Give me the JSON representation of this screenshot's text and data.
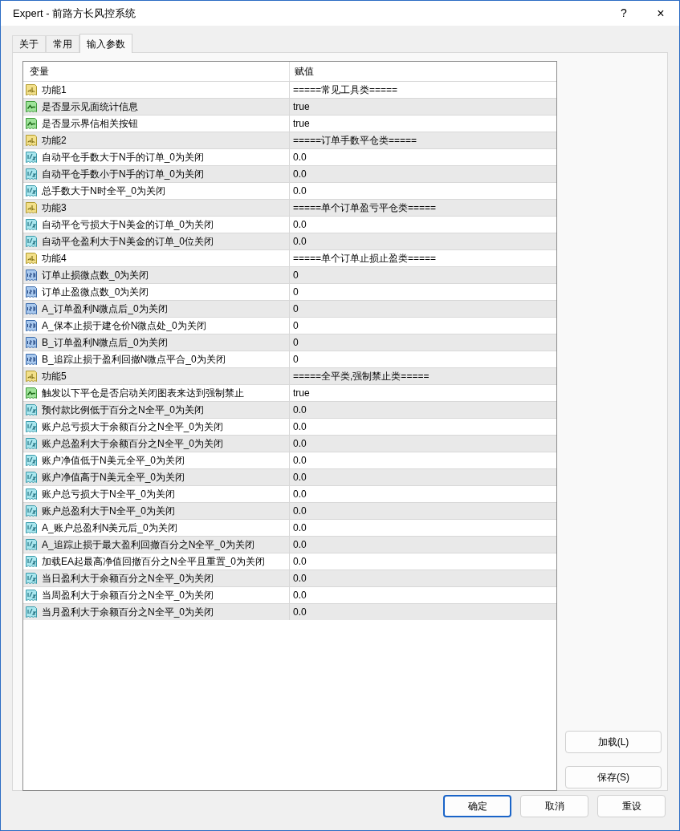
{
  "window": {
    "title": "Expert - 前路方长风控系统",
    "help": "?",
    "close": "×"
  },
  "tabs": [
    {
      "label": "关于",
      "selected": false
    },
    {
      "label": "常用",
      "selected": false
    },
    {
      "label": "输入参数",
      "selected": true
    }
  ],
  "table": {
    "columns": [
      "变量",
      "赋值"
    ],
    "rows": [
      {
        "kind": "string",
        "name": "功能1",
        "value": "=====常见工具类====="
      },
      {
        "kind": "bool",
        "name": "是否显示见面统计信息",
        "value": "true"
      },
      {
        "kind": "bool",
        "name": "是否显示界信相关按钮",
        "value": "true"
      },
      {
        "kind": "string",
        "name": "功能2",
        "value": "=====订单手数平仓类====="
      },
      {
        "kind": "double",
        "name": "自动平仓手数大于N手的订单_0为关闭",
        "value": "0.0"
      },
      {
        "kind": "double",
        "name": "自动平仓手数小于N手的订单_0为关闭",
        "value": "0.0"
      },
      {
        "kind": "double",
        "name": "总手数大于N时全平_0为关闭",
        "value": "0.0"
      },
      {
        "kind": "string",
        "name": "功能3",
        "value": "=====单个订单盈亏平仓类====="
      },
      {
        "kind": "double",
        "name": "自动平仓亏损大于N美金的订单_0为关闭",
        "value": "0.0"
      },
      {
        "kind": "double",
        "name": "自动平仓盈利大于N美金的订单_0位关闭",
        "value": "0.0"
      },
      {
        "kind": "string",
        "name": "功能4",
        "value": "=====单个订单止损止盈类====="
      },
      {
        "kind": "int",
        "name": "订单止损微点数_0为关闭",
        "value": "0"
      },
      {
        "kind": "int",
        "name": "订单止盈微点数_0为关闭",
        "value": "0"
      },
      {
        "kind": "int",
        "name": "A_订单盈利N微点后_0为关闭",
        "value": "0"
      },
      {
        "kind": "int",
        "name": "A_保本止损于建仓价N微点处_0为关闭",
        "value": "0"
      },
      {
        "kind": "int",
        "name": "B_订单盈利N微点后_0为关闭",
        "value": "0"
      },
      {
        "kind": "int",
        "name": "B_追踪止损于盈利回撤N微点平合_0为关闭",
        "value": "0"
      },
      {
        "kind": "string",
        "name": "功能5",
        "value": "=====全平类,强制禁止类====="
      },
      {
        "kind": "bool",
        "name": "触发以下平仓是否启动关闭图表来达到强制禁止",
        "value": "true"
      },
      {
        "kind": "double",
        "name": "预付款比例低于百分之N全平_0为关闭",
        "value": "0.0"
      },
      {
        "kind": "double",
        "name": "账户总亏损大于余额百分之N全平_0为关闭",
        "value": "0.0"
      },
      {
        "kind": "double",
        "name": "账户总盈利大于余额百分之N全平_0为关闭",
        "value": "0.0"
      },
      {
        "kind": "double",
        "name": "账户净值低于N美元全平_0为关闭",
        "value": "0.0"
      },
      {
        "kind": "double",
        "name": "账户净值高于N美元全平_0为关闭",
        "value": "0.0"
      },
      {
        "kind": "double",
        "name": "账户总亏损大于N全平_0为关闭",
        "value": "0.0"
      },
      {
        "kind": "double",
        "name": "账户总盈利大于N全平_0为关闭",
        "value": "0.0"
      },
      {
        "kind": "double",
        "name": "A_账户总盈利N美元后_0为关闭",
        "value": "0.0"
      },
      {
        "kind": "double",
        "name": "A_追踪止损于最大盈利回撤百分之N全平_0为关闭",
        "value": "0.0"
      },
      {
        "kind": "double",
        "name": "加载EA起最高净值回撤百分之N全平且重置_0为关闭",
        "value": "0.0"
      },
      {
        "kind": "double",
        "name": "当日盈利大于余额百分之N全平_0为关闭",
        "value": "0.0"
      },
      {
        "kind": "double",
        "name": "当周盈利大于余额百分之N全平_0为关闭",
        "value": "0.0"
      },
      {
        "kind": "double",
        "name": "当月盈利大于余额百分之N全平_0为关闭",
        "value": "0.0"
      }
    ]
  },
  "side_buttons": [
    "加载(L)",
    "保存(S)"
  ],
  "buttons": [
    {
      "label": "确定",
      "kind": "default"
    },
    {
      "label": "取消",
      "kind": "normal"
    },
    {
      "label": "重设",
      "kind": "normal"
    }
  ]
}
